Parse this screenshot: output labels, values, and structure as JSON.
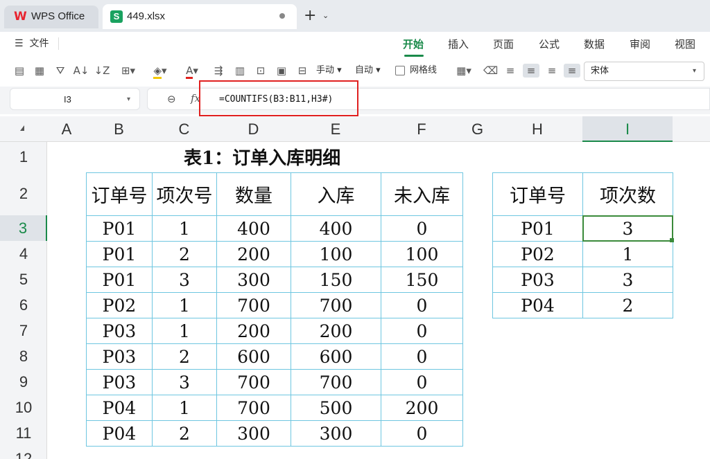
{
  "titlebar": {
    "home_tab": "WPS Office",
    "file_tab": "449.xlsx",
    "icons": [
      "wps-logo-icon",
      "sheet-icon",
      "unsaved-dot-icon",
      "new-tab-plus-icon",
      "chevron-down-icon"
    ]
  },
  "menu": {
    "file_label": "文件",
    "tabs": [
      "开始",
      "插入",
      "页面",
      "公式",
      "数据",
      "审阅",
      "视图"
    ],
    "active_tab": "开始"
  },
  "toolbar": {
    "manual_label": "手动",
    "auto_label": "自动",
    "gridlines_label": "网格线",
    "font_name": "宋体"
  },
  "formula_bar": {
    "cell_ref": "I3",
    "formula": "=COUNTIFS(B3:B11,H3#)"
  },
  "columns": [
    "A",
    "B",
    "C",
    "D",
    "E",
    "F",
    "G",
    "H",
    "I"
  ],
  "selected_column": "I",
  "rows": [
    "1",
    "2",
    "3",
    "4",
    "5",
    "6",
    "7",
    "8",
    "9",
    "10",
    "11",
    "12"
  ],
  "selected_row": "3",
  "sheet": {
    "title": "表1：订单入库明细",
    "table1": {
      "headers": [
        "订单号",
        "项次号",
        "数量",
        "入库",
        "未入库"
      ],
      "rows": [
        [
          "P01",
          "1",
          "400",
          "400",
          "0"
        ],
        [
          "P01",
          "2",
          "200",
          "100",
          "100"
        ],
        [
          "P01",
          "3",
          "300",
          "150",
          "150"
        ],
        [
          "P02",
          "1",
          "700",
          "700",
          "0"
        ],
        [
          "P03",
          "1",
          "200",
          "200",
          "0"
        ],
        [
          "P03",
          "2",
          "600",
          "600",
          "0"
        ],
        [
          "P03",
          "3",
          "700",
          "700",
          "0"
        ],
        [
          "P04",
          "1",
          "700",
          "500",
          "200"
        ],
        [
          "P04",
          "2",
          "300",
          "300",
          "0"
        ]
      ]
    },
    "table2": {
      "headers": [
        "订单号",
        "项次数"
      ],
      "rows": [
        [
          "P01",
          "3"
        ],
        [
          "P02",
          "1"
        ],
        [
          "P03",
          "3"
        ],
        [
          "P04",
          "2"
        ]
      ]
    }
  },
  "colors": {
    "accent": "#1a8a4a",
    "table_border": "#6ec6e0",
    "highlight_box": "#e02020"
  }
}
